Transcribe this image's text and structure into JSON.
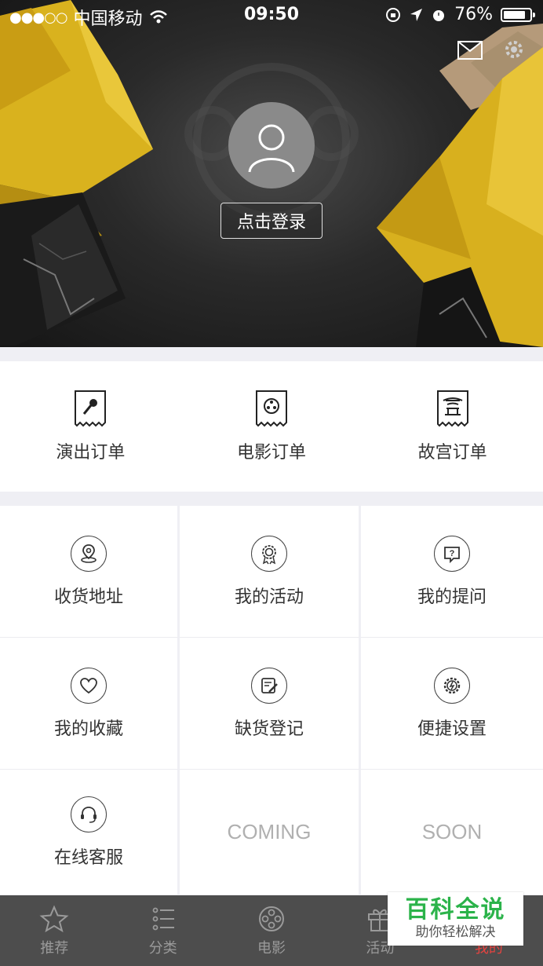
{
  "status_bar": {
    "signal": "●●●○○",
    "carrier": "中国移动",
    "time": "09:50",
    "battery": "76%"
  },
  "header": {
    "login_label": "点击登录"
  },
  "orders": [
    {
      "label": "演出订单",
      "icon": "microphone-ticket-icon"
    },
    {
      "label": "电影订单",
      "icon": "film-reel-ticket-icon"
    },
    {
      "label": "故宫订单",
      "icon": "palace-ticket-icon"
    }
  ],
  "grid": [
    {
      "label": "收货地址",
      "icon": "location-icon"
    },
    {
      "label": "我的活动",
      "icon": "medal-icon"
    },
    {
      "label": "我的提问",
      "icon": "question-icon"
    },
    {
      "label": "我的收藏",
      "icon": "heart-icon"
    },
    {
      "label": "缺货登记",
      "icon": "edit-note-icon"
    },
    {
      "label": "便捷设置",
      "icon": "gear-icon"
    },
    {
      "label": "在线客服",
      "icon": "headset-icon"
    },
    {
      "label": "COMING"
    },
    {
      "label": "SOON"
    }
  ],
  "tabs": [
    {
      "label": "推荐",
      "icon": "star-icon"
    },
    {
      "label": "分类",
      "icon": "list-icon"
    },
    {
      "label": "电影",
      "icon": "film-reel-icon"
    },
    {
      "label": "活动",
      "icon": "gift-icon"
    },
    {
      "label": "我的",
      "icon": "user-icon",
      "active": true
    }
  ],
  "watermark": {
    "title": "百科全说",
    "subtitle": "助你轻松解决"
  },
  "colors": {
    "accent_active": "#e64340",
    "tabbar_bg": "#4d4d4d",
    "watermark_green": "#2bb34a"
  }
}
